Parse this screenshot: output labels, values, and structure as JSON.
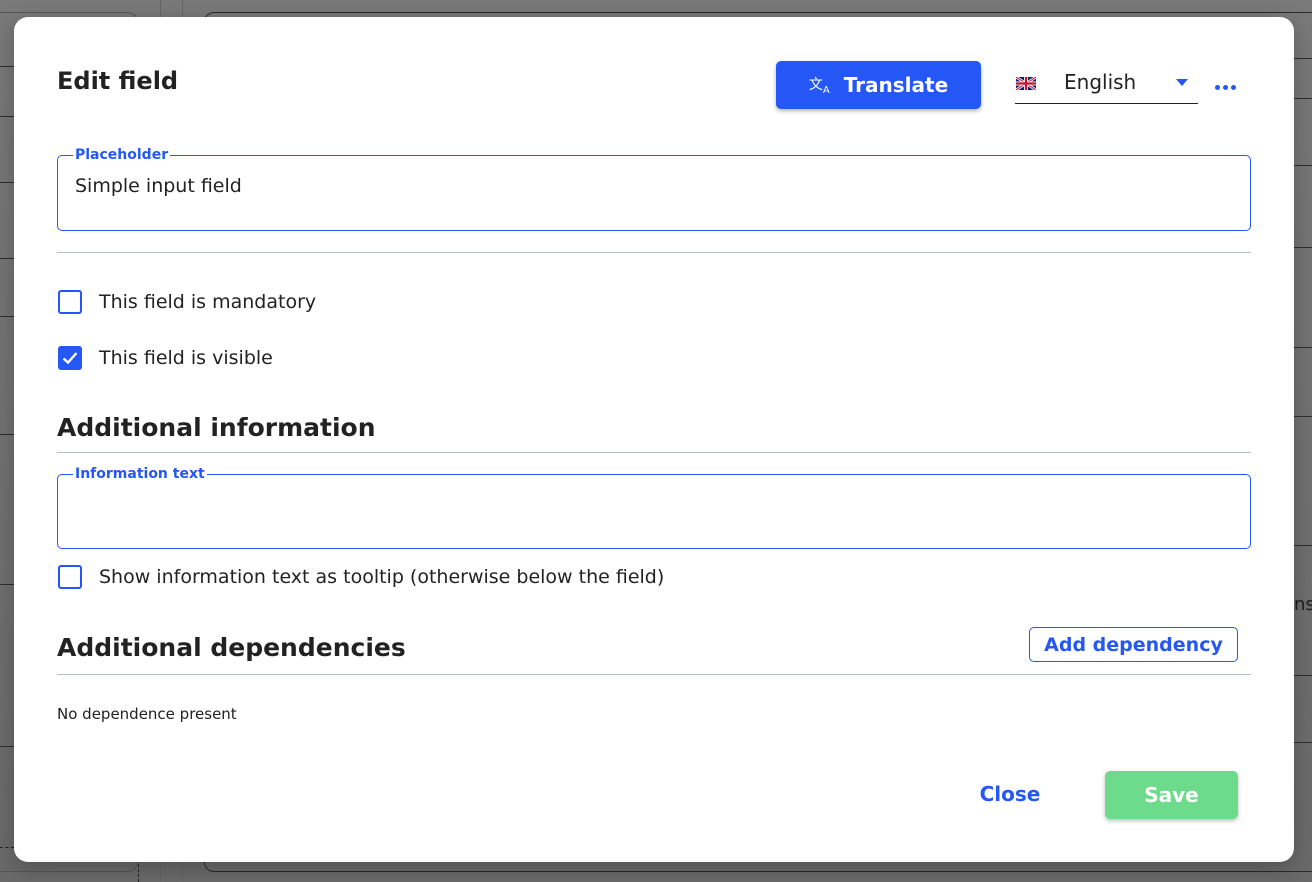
{
  "background": {
    "partial_text": "ns"
  },
  "dialog": {
    "title": "Edit field",
    "translate_button": {
      "label": "Translate",
      "icon": "translate-icon"
    },
    "language_select": {
      "selected": "English",
      "flag": "uk-flag-icon"
    },
    "more_menu": {
      "icon": "more-horizontal-icon"
    },
    "placeholder_field": {
      "label": "Placeholder",
      "value": "Simple input field"
    },
    "options": [
      {
        "label": "This field is mandatory",
        "checked": false
      },
      {
        "label": "This field is visible",
        "checked": true
      }
    ],
    "additional_information": {
      "heading": "Additional information",
      "info_field": {
        "label": "Information text",
        "value": ""
      },
      "tooltip_option": {
        "label": "Show information text as tooltip (otherwise below the field)",
        "checked": false
      }
    },
    "additional_dependencies": {
      "heading": "Additional dependencies",
      "add_button": "Add dependency",
      "empty_message": "No dependence present"
    },
    "footer": {
      "close_label": "Close",
      "save_label": "Save"
    },
    "colors": {
      "accent": "#2457f5",
      "save": "#6cdc8c",
      "divider": "#b5bccc"
    }
  }
}
